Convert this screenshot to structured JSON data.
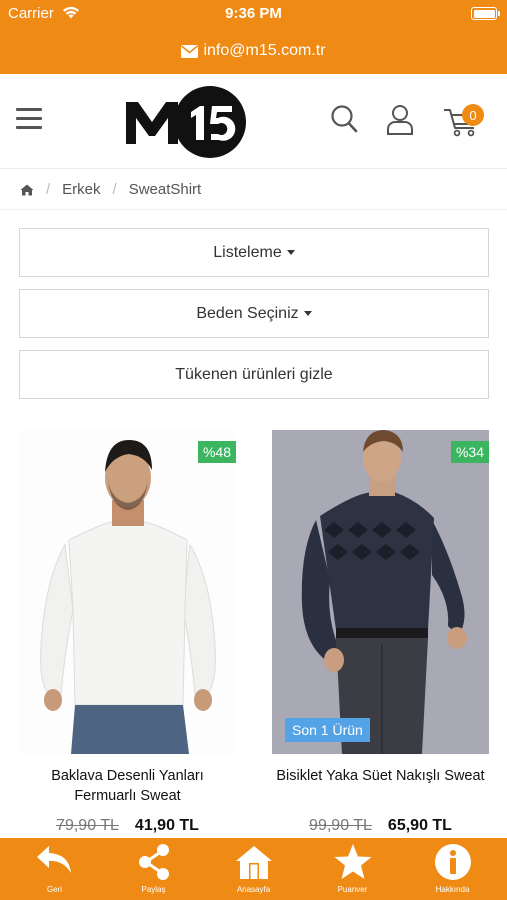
{
  "status_bar": {
    "carrier": "Carrier",
    "time": "9:36 PM"
  },
  "top_bar": {
    "email": "info@m15.com.tr"
  },
  "header": {
    "logo_text": "M15",
    "cart_count": "0"
  },
  "breadcrumb": {
    "items": [
      "Erkek",
      "SweatShirt"
    ]
  },
  "filters": {
    "sort_label": "Listeleme",
    "size_label": "Beden Seçiniz",
    "hide_sold_out_label": "Tükenen ürünleri gizle"
  },
  "products": [
    {
      "name": "Baklava Desenli Yanları Fermuarlı Sweat",
      "discount": "%48",
      "old_price": "79,90 TL",
      "new_price": "41,90 TL",
      "badge": ""
    },
    {
      "name": "Bisiklet Yaka Süet Nakışlı Sweat",
      "discount": "%34",
      "old_price": "99,90 TL",
      "new_price": "65,90 TL",
      "badge": "Son 1 Ürün"
    }
  ],
  "bottom_nav": [
    {
      "label": "Geri",
      "icon": "back-arrow-icon"
    },
    {
      "label": "Paylaş",
      "icon": "share-icon"
    },
    {
      "label": "Anasayfa",
      "icon": "home-icon"
    },
    {
      "label": "Puanver",
      "icon": "star-icon"
    },
    {
      "label": "Hakkında",
      "icon": "info-icon"
    }
  ],
  "colors": {
    "brand": "#ef8a14",
    "discount": "#3bb560",
    "last_item": "#54a3e6"
  }
}
